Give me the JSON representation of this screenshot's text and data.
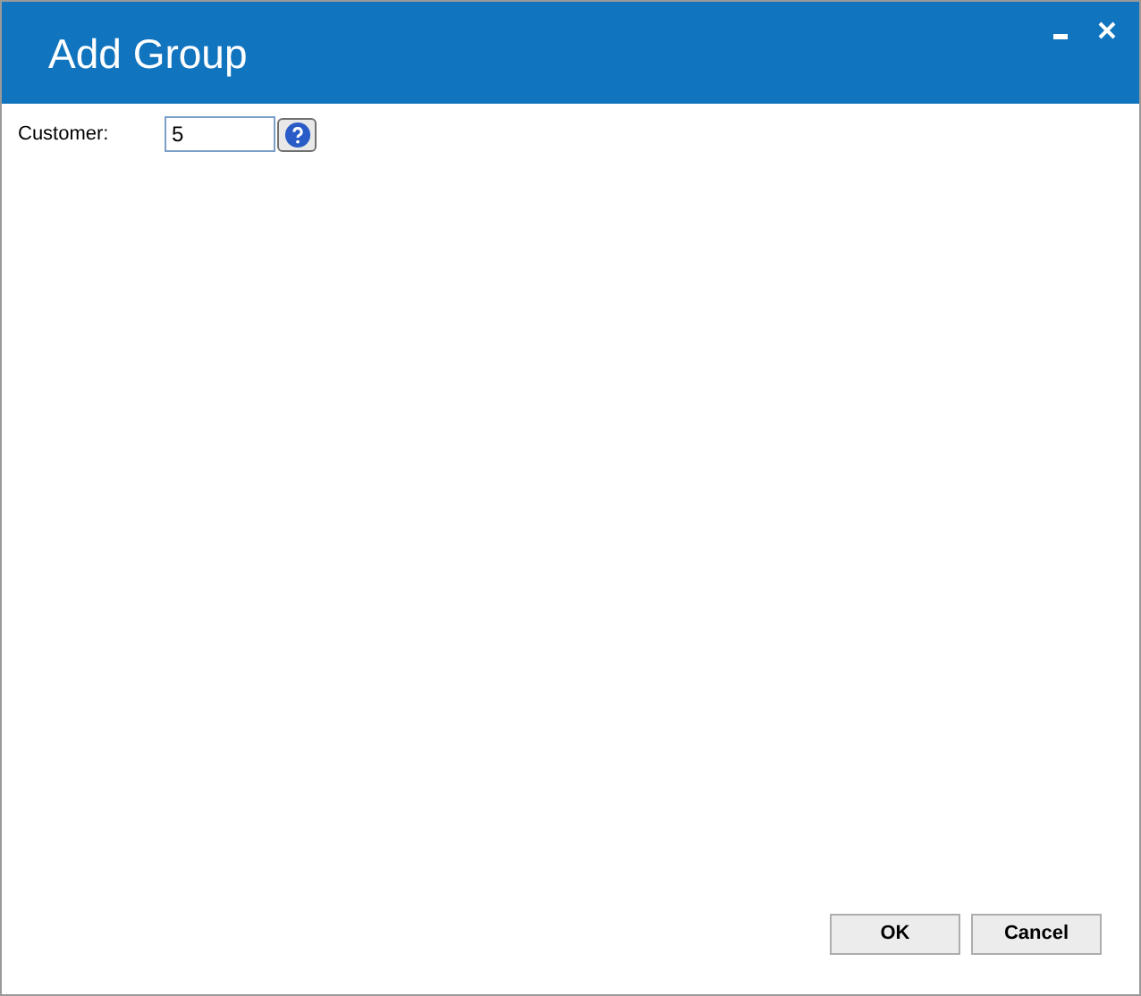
{
  "window": {
    "title": "Add Group"
  },
  "form": {
    "label": "Customer:",
    "value": "5"
  },
  "buttons": [
    {
      "label": "OK"
    },
    {
      "label": "Cancel"
    }
  ]
}
